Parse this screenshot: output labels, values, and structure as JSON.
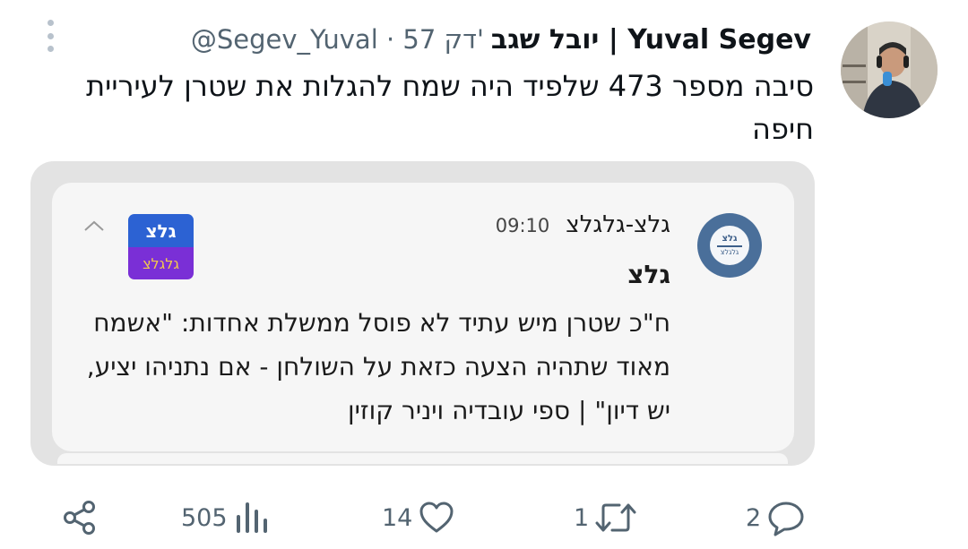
{
  "tweet": {
    "display_name": "יובל שגב | Yuval Segev",
    "handle_time": "@Segev_Yuval · 57 דק'",
    "text": "סיבה מספר 473 שלפיד היה שמח להגלות את שטרן לעיריית חיפה"
  },
  "embedded_notification": {
    "app_circle_logo_text": "גלצ",
    "app_circle_logo_sub": "גלגלצ",
    "app_name": "גלצ-גלגלצ",
    "time": "09:10",
    "sender": "גלצ",
    "body": "ח\"כ שטרן מיש עתיד לא פוסל ממשלת אחדות: \"אשמח מאוד שתהיה הצעה כזאת על השולחן - אם נתניהו יציע, יש דיון\" | ספי עובדיה ויניר קוזין",
    "logo_top_text": "גלצ",
    "logo_bottom_text": "גלגלצ",
    "colors": {
      "logo_top": "#2c62d3",
      "logo_bottom": "#7a2fd6",
      "app_circle": "#4a6f9a"
    }
  },
  "actions": {
    "share_icon": "share-icon",
    "views_count": "505",
    "likes_count": "14",
    "retweets_count": "1",
    "replies_count": "2"
  }
}
